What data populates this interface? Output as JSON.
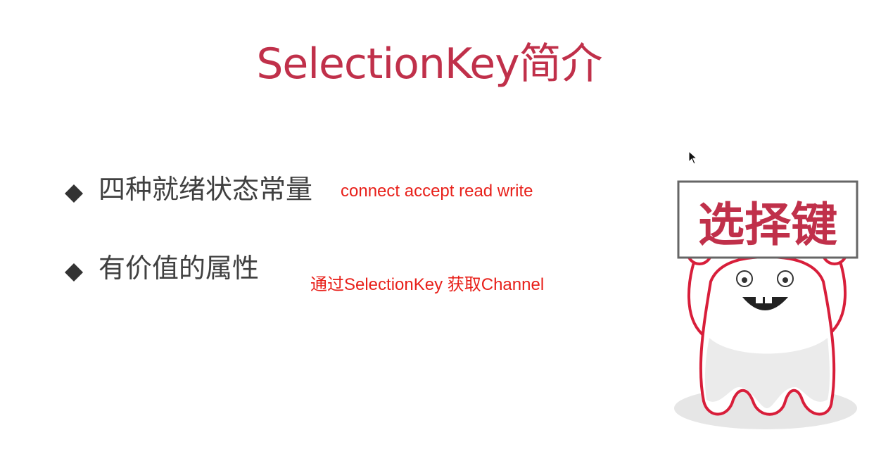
{
  "slide": {
    "title": "SelectionKey简介",
    "bullets": [
      {
        "text": "四种就绪状态常量"
      },
      {
        "text": "有价值的属性"
      }
    ],
    "annotations": [
      {
        "text": "connect accept read write"
      },
      {
        "text": "通过SelectionKey 获取Channel"
      }
    ],
    "mascot": {
      "sign_text": "选择键"
    }
  },
  "colors": {
    "title": "#c0304a",
    "bullet_text": "#404040",
    "annotation": "#e8201a",
    "mascot_outline": "#d81e3a"
  },
  "icons": [
    "diamond-bullet-icon",
    "mouse-cursor-icon",
    "mascot-illustration"
  ]
}
